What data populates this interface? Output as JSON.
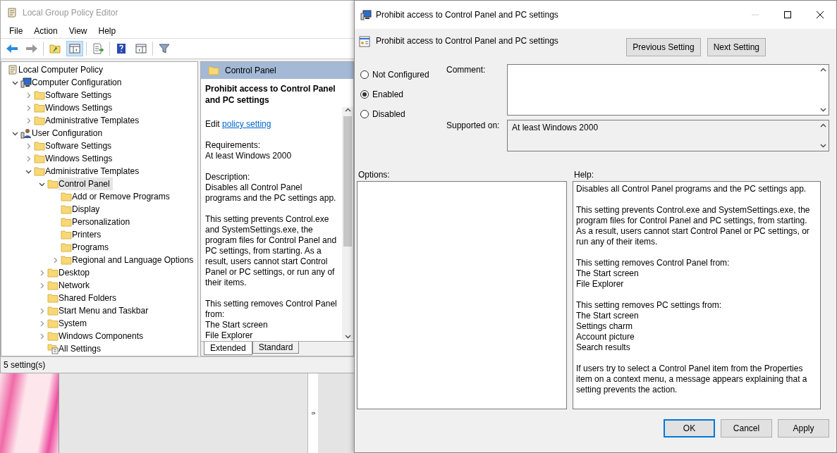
{
  "main_window": {
    "title": "Local Group Policy Editor",
    "menu": [
      "File",
      "Action",
      "View",
      "Help"
    ],
    "toolbar": {
      "back_enabled": true,
      "forward_enabled": false,
      "show_tree_pressed": true
    },
    "tree": [
      {
        "label": "Local Computer Policy",
        "kind": "policy",
        "selected": false,
        "children": [
          {
            "label": "Computer Configuration",
            "kind": "computer",
            "expanded": true,
            "selected": false,
            "children": [
              {
                "label": "Software Settings",
                "kind": "folder",
                "expanded": false,
                "selected": false
              },
              {
                "label": "Windows Settings",
                "kind": "folder",
                "expanded": false,
                "selected": false
              },
              {
                "label": "Administrative Templates",
                "kind": "folder",
                "expanded": false,
                "selected": false
              }
            ]
          },
          {
            "label": "User Configuration",
            "kind": "user",
            "expanded": true,
            "selected": false,
            "children": [
              {
                "label": "Software Settings",
                "kind": "folder",
                "expanded": false,
                "selected": false
              },
              {
                "label": "Windows Settings",
                "kind": "folder",
                "expanded": false,
                "selected": false
              },
              {
                "label": "Administrative Templates",
                "kind": "folder",
                "expanded": true,
                "selected": false,
                "children": [
                  {
                    "label": "Control Panel",
                    "kind": "folder",
                    "expanded": true,
                    "selected": true,
                    "children": [
                      {
                        "label": "Add or Remove Programs",
                        "kind": "folder",
                        "selected": false
                      },
                      {
                        "label": "Display",
                        "kind": "folder",
                        "selected": false
                      },
                      {
                        "label": "Personalization",
                        "kind": "folder",
                        "selected": false
                      },
                      {
                        "label": "Printers",
                        "kind": "folder",
                        "selected": false
                      },
                      {
                        "label": "Programs",
                        "kind": "folder",
                        "selected": false
                      },
                      {
                        "label": "Regional and Language Options",
                        "kind": "folder",
                        "expanded": false,
                        "selected": false
                      }
                    ]
                  },
                  {
                    "label": "Desktop",
                    "kind": "folder",
                    "expanded": false,
                    "selected": false
                  },
                  {
                    "label": "Network",
                    "kind": "folder",
                    "expanded": false,
                    "selected": false
                  },
                  {
                    "label": "Shared Folders",
                    "kind": "folder",
                    "selected": false
                  },
                  {
                    "label": "Start Menu and Taskbar",
                    "kind": "folder",
                    "expanded": false,
                    "selected": false
                  },
                  {
                    "label": "System",
                    "kind": "folder",
                    "expanded": false,
                    "selected": false
                  },
                  {
                    "label": "Windows Components",
                    "kind": "folder",
                    "expanded": false,
                    "selected": false
                  },
                  {
                    "label": "All Settings",
                    "kind": "settings",
                    "selected": false
                  }
                ]
              }
            ]
          }
        ]
      }
    ],
    "detail": {
      "header": "Control Panel",
      "title": "Prohibit access to Control Panel and PC settings",
      "edit_prefix": "Edit",
      "edit_link": "policy setting",
      "paragraphs": [
        [
          "Requirements:",
          "At least Windows 2000"
        ],
        [
          "Description:",
          "Disables all Control Panel programs and the PC settings app."
        ],
        [
          "This setting prevents Control.exe and SystemSettings.exe, the program files for Control Panel and PC settings, from starting. As a result, users cannot start Control Panel or PC settings, or run any of their items."
        ],
        [
          "This setting removes Control Panel from:",
          "The Start screen",
          "File Explorer"
        ]
      ],
      "tabs": [
        {
          "label": "Extended",
          "selected": true
        },
        {
          "label": "Standard",
          "selected": false
        }
      ]
    },
    "status_bar": "5 setting(s)"
  },
  "background": {
    "ruler_label": "6"
  },
  "dialog": {
    "title": "Prohibit access to Control Panel and PC settings",
    "minimize_enabled": false,
    "setting_name": "Prohibit access to Control Panel and PC settings",
    "nav_buttons": [
      "Previous Setting",
      "Next Setting"
    ],
    "states": [
      {
        "label": "Not Configured",
        "selected": false
      },
      {
        "label": "Enabled",
        "selected": true
      },
      {
        "label": "Disabled",
        "selected": false
      }
    ],
    "comment_label": "Comment:",
    "supported_label": "Supported on:",
    "supported_value": "At least Windows 2000",
    "options_label": "Options:",
    "help_label": "Help:",
    "help": [
      [
        "Disables all Control Panel programs and the PC settings app."
      ],
      [
        "This setting prevents Control.exe and SystemSettings.exe, the program files for Control Panel and PC settings, from starting. As a result, users cannot start Control Panel or PC settings, or run any of their items."
      ],
      [
        "This setting removes Control Panel from:",
        "The Start screen",
        "File Explorer"
      ],
      [
        "This setting removes PC settings from:",
        "The Start screen",
        "Settings charm",
        "Account picture",
        "Search results"
      ],
      [
        "If users try to select a Control Panel item from the Properties item on a context menu, a message appears explaining that a setting prevents the action."
      ]
    ],
    "buttons": [
      {
        "label": "OK",
        "default": true
      },
      {
        "label": "Cancel",
        "default": false
      },
      {
        "label": "Apply",
        "default": false
      }
    ]
  }
}
